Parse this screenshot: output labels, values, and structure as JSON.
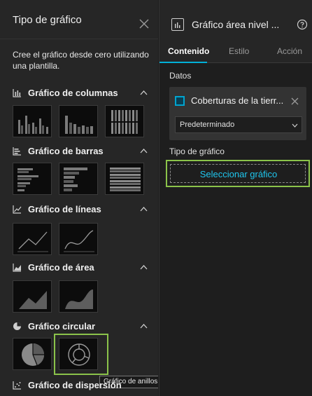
{
  "left_panel": {
    "title": "Tipo de gráfico",
    "description": "Cree el gráfico desde cero utilizando una plantilla.",
    "sections": [
      {
        "label": "Gráfico de columnas",
        "icon": "column-chart-icon"
      },
      {
        "label": "Gráfico de barras",
        "icon": "bar-chart-icon"
      },
      {
        "label": "Gráfico de líneas",
        "icon": "line-chart-icon"
      },
      {
        "label": "Gráfico de área",
        "icon": "area-chart-icon"
      },
      {
        "label": "Gráfico circular",
        "icon": "pie-chart-icon"
      },
      {
        "label": "Gráfico de dispersión",
        "icon": "scatter-chart-icon"
      }
    ],
    "tooltip": "Gráfico de anillos"
  },
  "right_panel": {
    "title": "Gráfico área nivel ...",
    "tabs": [
      "Contenido",
      "Estilo",
      "Acción"
    ],
    "active_tab": "Contenido",
    "datos_label": "Datos",
    "data_source": "Coberturas de la tierr...",
    "select_value": "Predeterminado",
    "chart_type_label": "Tipo de gráfico",
    "select_chart_button": "Seleccionar gráfico"
  },
  "colors": {
    "accent": "#00b0d7",
    "highlight": "#8bc34a",
    "button_text": "#1fc6ee",
    "panel_bg": "#262626"
  }
}
